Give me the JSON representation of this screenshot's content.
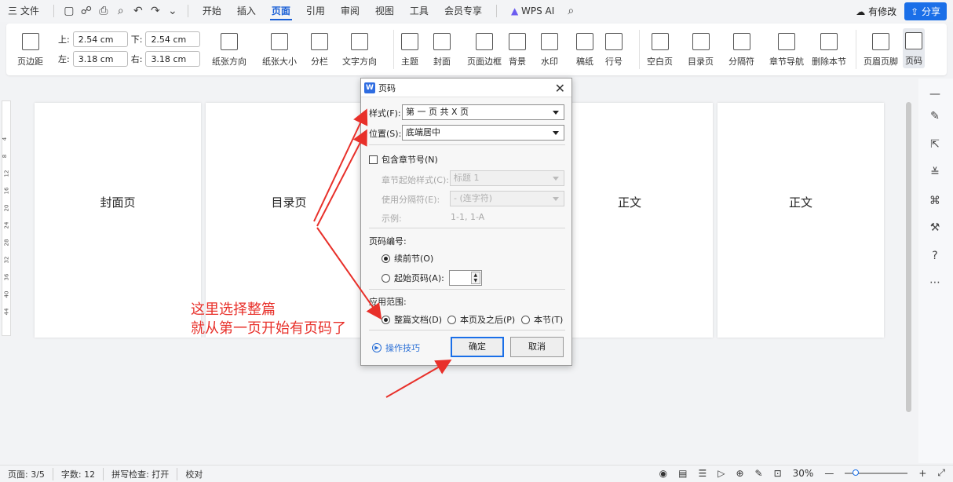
{
  "menubar": {
    "file": "三 文件",
    "tabs": [
      "开始",
      "插入",
      "页面",
      "引用",
      "审阅",
      "视图",
      "工具",
      "会员专享"
    ],
    "active_tab": "页面",
    "wps_ai": "WPS AI",
    "modified": "有修改",
    "share": "分享"
  },
  "ribbon": {
    "margins": {
      "label": "页边距",
      "top_label": "上:",
      "top": "2.54",
      "bottom_label": "下:",
      "bottom": "2.54",
      "left_label": "左:",
      "left": "3.18",
      "right_label": "右:",
      "right": "3.18",
      "unit": "cm"
    },
    "buttons": [
      "纸张方向",
      "纸张大小",
      "分栏",
      "文字方向",
      "主题",
      "封面",
      "页面边框",
      "背景",
      "水印",
      "稿纸",
      "行号",
      "空白页",
      "目录页",
      "分隔符",
      "章节导航",
      "删除本节",
      "页眉页脚",
      "页码"
    ]
  },
  "pages": [
    "封面页",
    "目录页",
    "",
    "正文",
    "正文"
  ],
  "dialog": {
    "title": "页码",
    "style_label": "样式(F):",
    "style_value": "第 一 页 共 X 页",
    "position_label": "位置(S):",
    "position_value": "底端居中",
    "include_chapter": "包含章节号(N)",
    "chapter_start_label": "章节起始样式(C):",
    "chapter_start_value": "标题 1",
    "separator_label": "使用分隔符(E):",
    "separator_value": "-  (连字符)",
    "example_label": "示例:",
    "example_value": "1-1, 1-A",
    "numbering_label": "页码编号:",
    "continue": "续前节(O)",
    "start_at": "起始页码(A):",
    "apply_label": "应用范围:",
    "apply_whole": "整篇文档(D)",
    "apply_after": "本页及之后(P)",
    "apply_section": "本节(T)",
    "tips": "操作技巧",
    "ok": "确定",
    "cancel": "取消"
  },
  "annotation": {
    "line1": "这里选择整篇",
    "line2": "就从第一页开始有页码了"
  },
  "statusbar": {
    "page": "页面: 3/5",
    "words": "字数: 12",
    "spell": "拼写检查: 打开",
    "proof": "校对",
    "zoom": "30%"
  },
  "ruler_numbers": [
    "4",
    "8",
    "12",
    "16",
    "20",
    "24",
    "28",
    "32",
    "36",
    "40",
    "44"
  ],
  "colors": {
    "accent": "#1a6fe8",
    "annotation": "#e8302a"
  }
}
